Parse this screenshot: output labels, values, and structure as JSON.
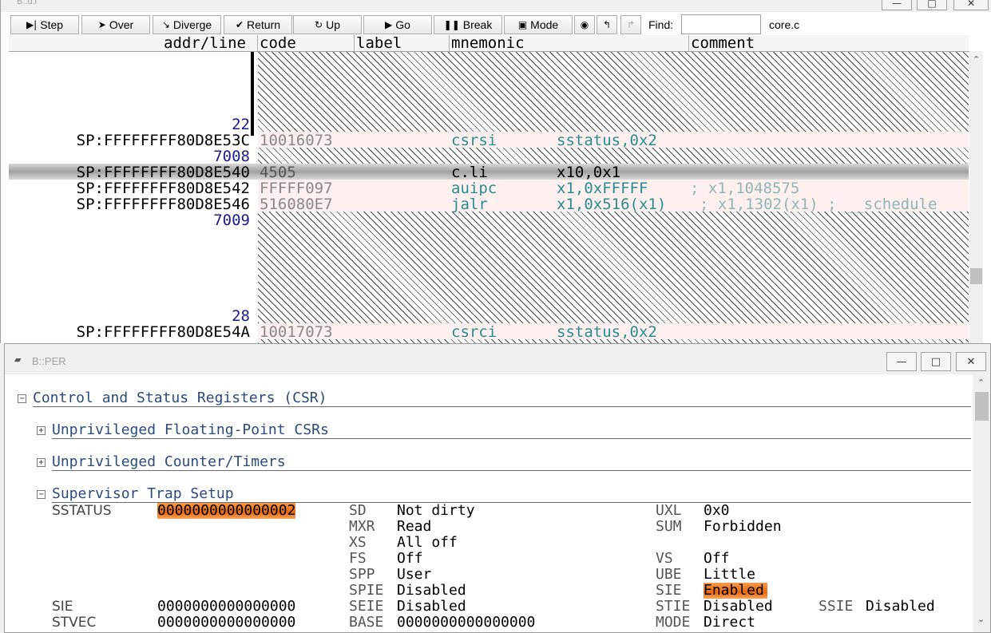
{
  "list_window": {
    "title": "B::d.l",
    "toolbar": {
      "buttons": [
        {
          "label": "Step",
          "icon": "step-icon"
        },
        {
          "label": "Over",
          "icon": "over-icon"
        },
        {
          "label": "Diverge",
          "icon": "diverge-icon"
        },
        {
          "label": "Return",
          "icon": "return-icon"
        },
        {
          "label": "Up",
          "icon": "up-icon"
        },
        {
          "label": "Go",
          "icon": "go-icon"
        },
        {
          "label": "Break",
          "icon": "break-icon"
        },
        {
          "label": "Mode",
          "icon": "mode-icon"
        }
      ],
      "find_label": "Find:",
      "find_value": "",
      "file": "core.c"
    },
    "columns": {
      "addr": "addr/line",
      "code": "code",
      "label": "label",
      "mnemonic": "mnemonic",
      "comment": "comment"
    },
    "lines": [
      {
        "kind": "line",
        "addr": "22"
      },
      {
        "kind": "instr",
        "addr": "SP:FFFFFFFF80D8E53C",
        "code": "10016073",
        "mnemonic": "csrsi",
        "operands": "sstatus,0x2",
        "comment": ""
      },
      {
        "kind": "line",
        "addr": "7008"
      },
      {
        "kind": "instr",
        "addr": "SP:FFFFFFFF80D8E540",
        "code": "4505",
        "mnemonic": "c.li",
        "operands": "x10,0x1",
        "comment": "",
        "current": true
      },
      {
        "kind": "instr",
        "addr": "SP:FFFFFFFF80D8E542",
        "code": "FFFFF097",
        "mnemonic": "auipc",
        "operands": "x1,0xFFFFF",
        "comment": "; x1,1048575"
      },
      {
        "kind": "instr",
        "addr": "SP:FFFFFFFF80D8E546",
        "code": "516080E7",
        "mnemonic": "jalr",
        "operands": "x1,0x516(x1)",
        "comment": "; x1,1302(x1) ; __schedule"
      },
      {
        "kind": "line",
        "addr": "7009"
      },
      {
        "kind": "line",
        "addr": "28"
      },
      {
        "kind": "instr",
        "addr": "SP:FFFFFFFF80D8E54A",
        "code": "10017073",
        "mnemonic": "csrci",
        "operands": "sstatus,0x2",
        "comment": ""
      }
    ]
  },
  "per_window": {
    "title": "B::PER",
    "tree": {
      "root": "Control and Status Registers (CSR)",
      "groups": [
        {
          "label": "Unprivileged Floating-Point CSRs",
          "expanded": false
        },
        {
          "label": "Unprivileged Counter/Timers",
          "expanded": false
        },
        {
          "label": "Supervisor Trap Setup",
          "expanded": true
        }
      ]
    },
    "registers": {
      "sstatus": {
        "name": "SSTATUS",
        "value": "0000000000000002",
        "fields_mid": [
          {
            "name": "SD",
            "value": "Not dirty"
          },
          {
            "name": "MXR",
            "value": "Read"
          },
          {
            "name": "XS",
            "value": "All off"
          },
          {
            "name": "FS",
            "value": "Off"
          },
          {
            "name": "SPP",
            "value": "User"
          },
          {
            "name": "SPIE",
            "value": "Disabled"
          }
        ],
        "fields_right": [
          {
            "name": "UXL",
            "value": "0x0"
          },
          {
            "name": "SUM",
            "value": "Forbidden"
          },
          {
            "name": "VS",
            "value": "Off"
          },
          {
            "name": "UBE",
            "value": "Little"
          },
          {
            "name": "SIE",
            "value": "Enabled"
          }
        ]
      },
      "sie": {
        "name": "SIE",
        "value": "0000000000000000",
        "fields": [
          {
            "name": "SEIE",
            "value": "Disabled"
          },
          {
            "name": "STIE",
            "value": "Disabled"
          },
          {
            "name": "SSIE",
            "value": "Disabled"
          }
        ]
      },
      "stvec": {
        "name": "STVEC",
        "value": "0000000000000000",
        "fields": [
          {
            "name": "BASE",
            "value": "0000000000000000"
          },
          {
            "name": "MODE",
            "value": "Direct"
          }
        ]
      }
    }
  },
  "colors": {
    "highlight": "#e86810",
    "mnemonic": "#2a8c8c",
    "line_number": "#1a1a8c",
    "tree_label": "#2c4a7a"
  }
}
